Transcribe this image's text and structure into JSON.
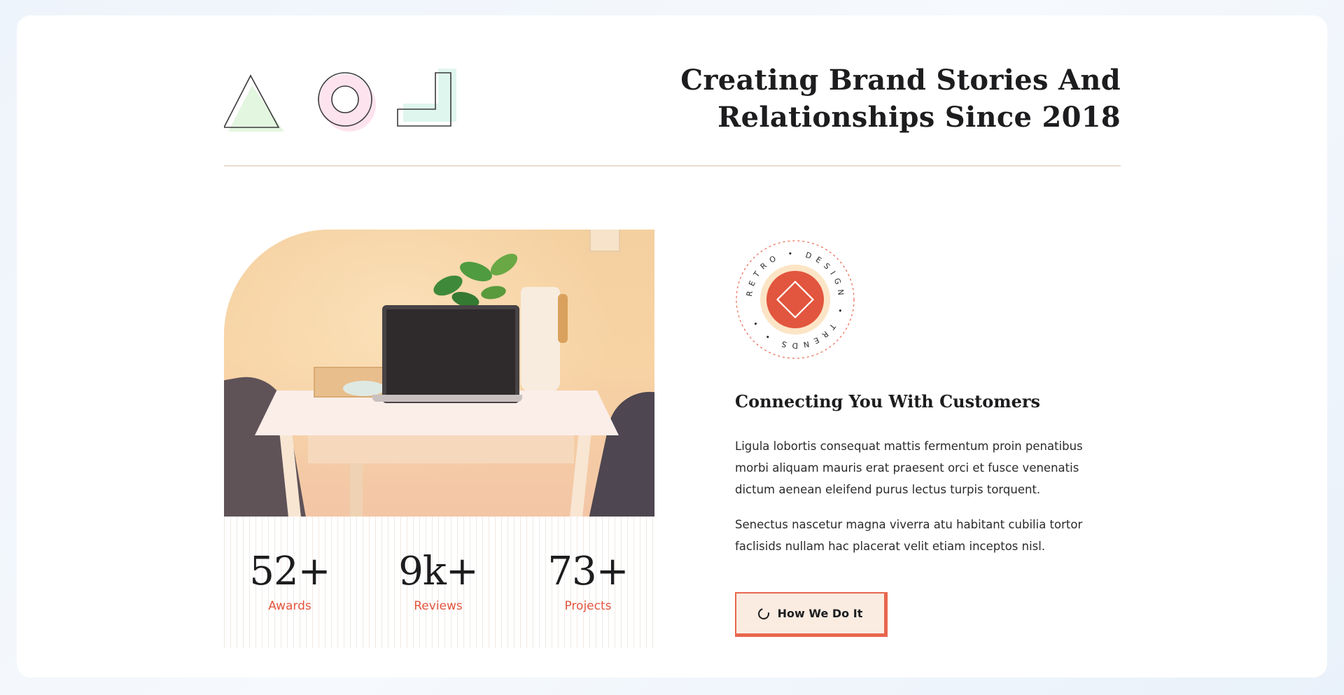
{
  "header": {
    "headline_line1": "Creating Brand Stories And",
    "headline_line2": "Relationships Since 2018",
    "shape_icons": [
      "triangle-icon",
      "circle-icon",
      "l-shape-icon"
    ]
  },
  "stats": [
    {
      "value": "52+",
      "label": "Awards"
    },
    {
      "value": "9k+",
      "label": "Reviews"
    },
    {
      "value": "73+",
      "label": "Projects"
    }
  ],
  "badge": {
    "ring_text": "RETRO • DESIGN • TRENDS • •",
    "icon": "diamond-icon"
  },
  "content": {
    "subheading": "Connecting You With Customers",
    "paragraph1": "Ligula lobortis consequat mattis fermentum proin penatibus morbi aliquam mauris erat praesent orci et fusce venenatis dictum aenean eleifend purus lectus turpis torquent.",
    "paragraph2": "Senectus nascetur magna viverra atu habitant cubilia tortor faclisids nullam hac placerat velit etiam inceptos nisl."
  },
  "cta": {
    "label": "How We Do It",
    "icon": "loading-circle-icon"
  },
  "colors": {
    "accent": "#e2553e",
    "accent_light": "#fbece1",
    "text": "#1d1d1f",
    "rule": "#eadbd0"
  }
}
